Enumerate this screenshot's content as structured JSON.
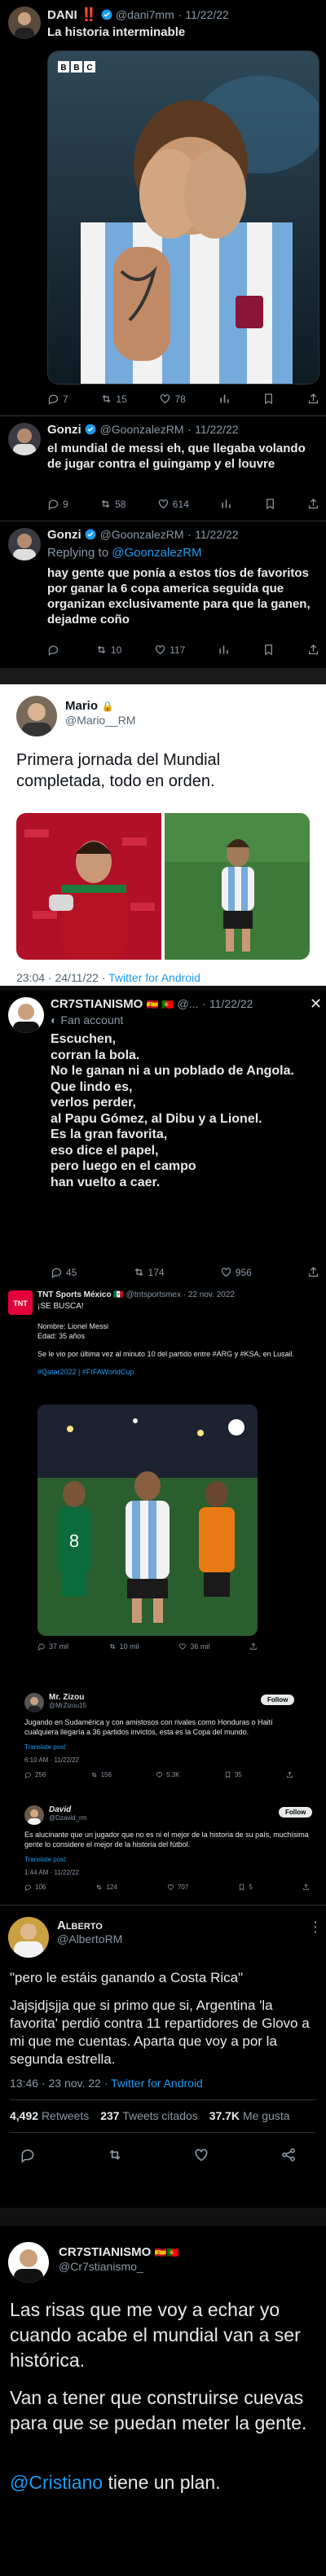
{
  "t1": {
    "name": "DANI",
    "emoji": "‼️",
    "handle": "@dani7mm",
    "date": "11/22/22",
    "text": "La historia interminable",
    "bbc": "BBC",
    "stats": {
      "replies": "7",
      "retweets": "15",
      "likes": "78"
    }
  },
  "t2": {
    "name": "Gonzi",
    "handle": "@GoonzalezRM",
    "date": "11/22/22",
    "text": "el mundial de messi eh, que llegaba volando de jugar contra el guingamp y el louvre",
    "stats": {
      "replies": "9",
      "retweets": "58",
      "likes": "614"
    }
  },
  "t3": {
    "name": "Gonzi",
    "handle": "@GoonzalezRM",
    "date": "11/22/22",
    "reply_prefix": "Replying to",
    "reply_to": "@GoonzalezRM",
    "text": "hay gente que ponía a estos tíos de favoritos por ganar la 6 copa america seguida que organizan exclusivamente para que la ganen, dejadme coño",
    "stats": {
      "replies": "",
      "retweets": "10",
      "likes": "117"
    }
  },
  "t4": {
    "name": "Mario",
    "lock": "🔒",
    "handle": "@Mario__RM",
    "text": "Primera jornada del Mundial completada, todo en orden.",
    "time": "23:04 · 24/11/22 ·",
    "client": "Twitter for Android"
  },
  "t5": {
    "name": "CR7STIANISMO",
    "flags": "🇪🇸 🇵🇹",
    "handle": "@...",
    "date": "11/22/22",
    "fan_label": "Fan account",
    "lines": [
      "Escuchen,",
      "corran la bola.",
      "No le ganan ni a un poblado de Angola.",
      "Que lindo es,",
      "verlos perder,",
      "al Papu Gómez, al Dibu y a Lionel.",
      "Es la gran favorita,",
      "eso dice el papel,",
      "pero luego en el campo",
      "han vuelto a caer."
    ],
    "stats": {
      "replies": "45",
      "retweets": "174",
      "likes": "956"
    }
  },
  "t6": {
    "name": "TNT Sports México",
    "flag": "🇲🇽",
    "handle": "@tntsportsmex · 22 nov. 2022",
    "sub": "¡SE BUSCA!",
    "body1": "Nombre: Lionel Messi",
    "body2": "Edad: 35 años",
    "body3": "Se le vio por última vez al minuto 10 del partido entre #ARG y #KSA, en Lusail.",
    "tags": "#Qatar2022 | #FIFAWorldCup",
    "stats": {
      "replies": "37 mil",
      "retweets": "10 mil",
      "likes": "36 mil"
    }
  },
  "t7": {
    "name": "Mr. Zizou",
    "handle": "@MrZizou15",
    "follow": "Follow",
    "text": "Jugando en Sudamérica y con amistosos con rivales como Honduras o Haití cualquiera llegaría a 36 partidos invictos, esta es la Copa del mundo.",
    "translate": "Translate post",
    "time": "6:10 AM · 11/22/22",
    "stats": {
      "replies": "256",
      "retweets": "156",
      "likes": "5.3K",
      "views": "35"
    }
  },
  "t8": {
    "name": "David",
    "handle": "@Dzavid_rm",
    "follow": "Follow",
    "text": "Es alucinante que un jugador que no es ni el mejor de la historia de su país, muchísima gente lo considere el mejor de la historia del fútbol.",
    "translate": "Translate post",
    "time": "1:44 AM · 11/22/22",
    "stats": {
      "replies": "106",
      "retweets": "124",
      "likes": "707",
      "views": "5"
    }
  },
  "t9": {
    "name": "Alberto",
    "handle": "@AlbertoRM",
    "quote": "\"pero le estáis ganando a Costa Rica\"",
    "text": "Jajsjdjsjja que si primo que si, Argentina 'la favorita' perdió contra 11 repartidores de Glovo a mi que me cuentas. Aparta que voy a por la segunda estrella.",
    "time": "13:46 · 23 nov. 22 ·",
    "client": "Twitter for Android",
    "retweets": "4,492",
    "retweets_label": "Retweets",
    "quotes": "237",
    "quotes_label": "Tweets citados",
    "likes": "37.7K",
    "likes_label": "Me gusta"
  },
  "t10": {
    "name": "CR7STIANISMO",
    "flags": "🇪🇸🇵🇹",
    "handle": "@Cr7stianismo_",
    "text1": "Las risas que me voy a echar yo cuando acabe el mundial van a ser histórica.",
    "text2": "Van a tener que construirse cuevas para que se puedan meter la gente.",
    "mention": "@Cristiano",
    "text3": " tiene un plan."
  },
  "colors": {
    "link": "#1d9bf0",
    "muted": "#8b98a5",
    "argentina_blue": "#75aadb",
    "portugal_red": "#c8102e"
  }
}
